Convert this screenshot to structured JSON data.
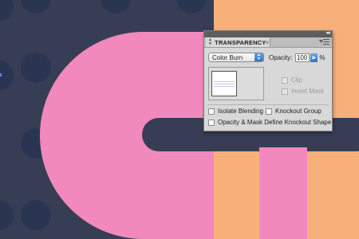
{
  "artwork": {
    "background_color": "#373d55",
    "dot_color": "#2a3552",
    "pink_color": "#f189bd",
    "orange_color": "#f8b07a"
  },
  "panel": {
    "collapse_glyph": "◂◂",
    "tab_label": "TRANSPARENCY",
    "tab_close": "×",
    "blend_mode": "Color Burn",
    "opacity_label": "Opacity:",
    "opacity_value": "100",
    "opacity_unit": "%",
    "clip_label": "Clip",
    "invert_mask_label": "Invert Mask",
    "isolate_blending_label": "Isolate Blending",
    "knockout_group_label": "Knockout Group",
    "opacity_mask_label": "Opacity & Mask Define Knockout Shape",
    "icons": [
      "panel-collapse-icon",
      "tab-arrows-icon",
      "close-icon",
      "panel-menu-icon",
      "dropdown-caret-icon",
      "slider-arrow-icon"
    ]
  }
}
